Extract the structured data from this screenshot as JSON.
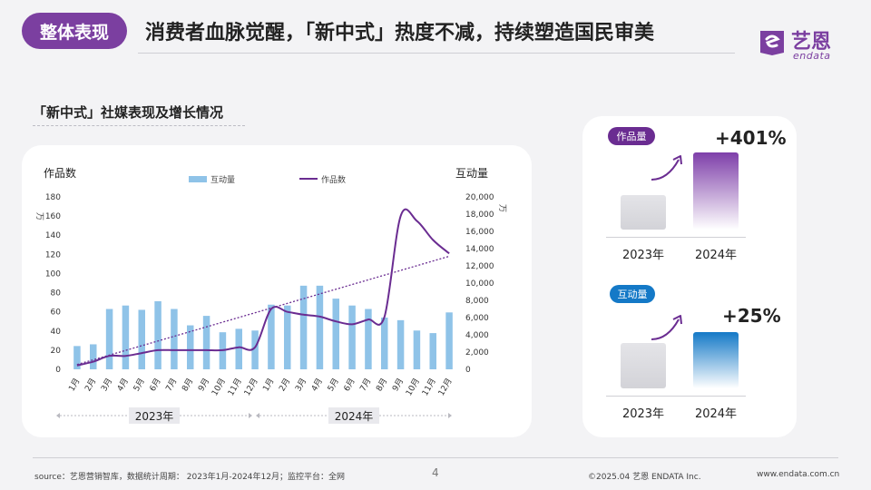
{
  "header": {
    "section_tag": "整体表现",
    "headline": "消费者血脉觉醒，「新中式」热度不减，持续塑造国民审美",
    "logo_cn": "艺恩",
    "logo_en": "endata"
  },
  "section": {
    "title": "「新中式」社媒表现及增长情况"
  },
  "chart_data": {
    "type": "bar",
    "categories": [
      "1月",
      "2月",
      "3月",
      "4月",
      "5月",
      "6月",
      "7月",
      "8月",
      "9月",
      "10月",
      "11月",
      "12月",
      "1月",
      "2月",
      "3月",
      "4月",
      "5月",
      "6月",
      "7月",
      "8月",
      "9月",
      "10月",
      "11月",
      "12月"
    ],
    "year_groups": [
      "2023年",
      "2024年"
    ],
    "series": [
      {
        "name": "互动量",
        "kind": "bar",
        "axis": "right",
        "color": "#8fc3e8",
        "values": [
          2700,
          2900,
          7000,
          7400,
          6900,
          7900,
          7000,
          5100,
          6200,
          4300,
          4700,
          4500,
          7500,
          7400,
          9700,
          9700,
          8200,
          7400,
          7000,
          6000,
          5700,
          4500,
          4200,
          6600
        ]
      },
      {
        "name": "作品数",
        "kind": "line",
        "axis": "left",
        "color": "#6a2c91",
        "values": [
          4,
          8,
          14,
          14,
          17,
          20,
          20,
          20,
          20,
          20,
          23,
          23,
          63,
          60,
          57,
          55,
          50,
          47,
          52,
          55,
          160,
          155,
          135,
          121
        ]
      }
    ],
    "trendline": {
      "series": "作品数",
      "from": 5,
      "to": 118
    },
    "left_axis": {
      "label": "作品数",
      "unit": "万",
      "ylim": [
        0,
        180
      ],
      "ticks": [
        "0",
        "20",
        "40",
        "60",
        "80",
        "100",
        "120",
        "140",
        "160",
        "180"
      ]
    },
    "right_axis": {
      "label": "互动量",
      "unit": "万",
      "ylim": [
        0,
        20000
      ],
      "ticks": [
        "0",
        "2,000",
        "4,000",
        "6,000",
        "8,000",
        "10,000",
        "12,000",
        "14,000",
        "16,000",
        "18,000",
        "20,000"
      ]
    },
    "legend_position": "top-center",
    "grid": false
  },
  "growth": {
    "works": {
      "label": "作品量",
      "pct": "+401%",
      "year_a": "2023年",
      "year_b": "2024年",
      "ratio": 5.01,
      "color": "#6a2c91"
    },
    "interactions": {
      "label": "互动量",
      "pct": "+25%",
      "year_a": "2023年",
      "year_b": "2024年",
      "ratio": 1.25,
      "color": "#1479c7"
    }
  },
  "footer": {
    "source": "source：艺恩营销智库，数据统计周期： 2023年1月-2024年12月；监控平台：全网",
    "page": "4",
    "copyright": "©2025.04 艺恩 ENDATA Inc.",
    "url": "www.endata.com.cn"
  }
}
